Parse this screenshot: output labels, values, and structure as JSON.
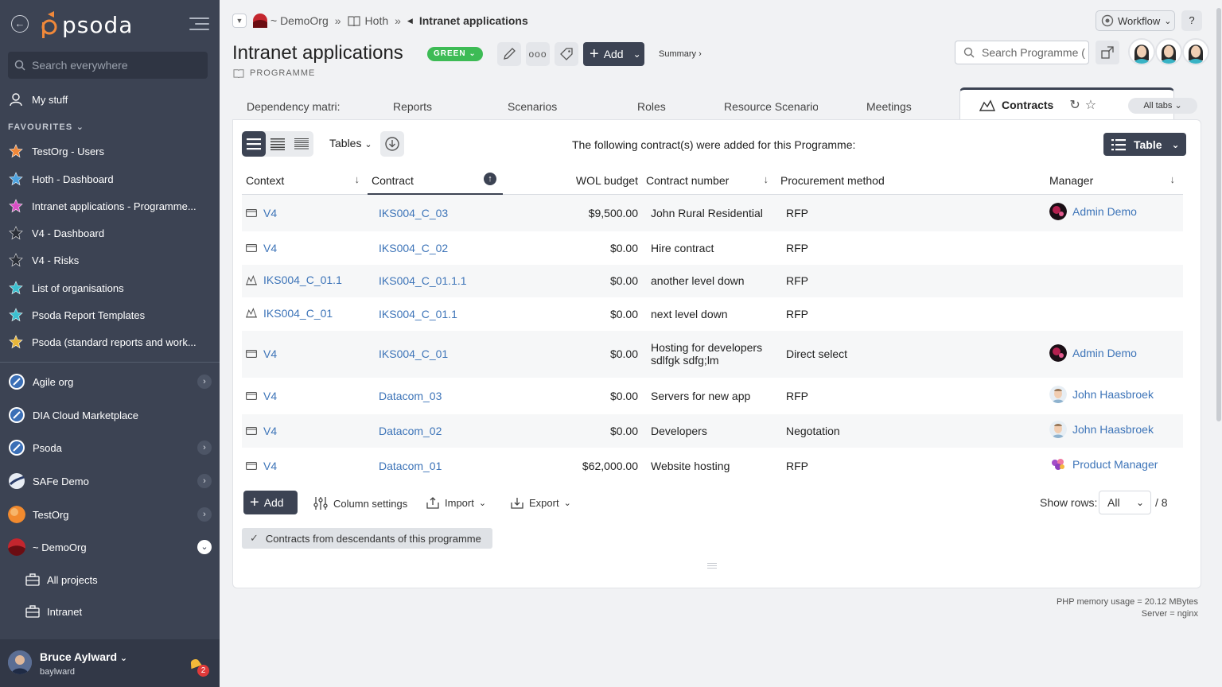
{
  "sidebar": {
    "logo_text": "psoda",
    "search_placeholder": "Search everywhere",
    "my_stuff": "My stuff",
    "favourites_header": "FAVOURITES",
    "favourites": [
      {
        "label": "TestOrg - Users",
        "color": "#f0883a"
      },
      {
        "label": "Hoth - Dashboard",
        "color": "#4da3e0"
      },
      {
        "label": "Intranet applications - Programme...",
        "color": "#d94fc4"
      },
      {
        "label": "V4 - Dashboard",
        "color": "#2b2f38"
      },
      {
        "label": "V4 - Risks",
        "color": "#2b2f38"
      },
      {
        "label": "List of organisations",
        "color": "#3cc0d0"
      },
      {
        "label": "Psoda Report Templates",
        "color": "#3cc0d0"
      },
      {
        "label": "Psoda (standard reports and work...",
        "color": "#e8b63a"
      }
    ],
    "orgs": [
      {
        "label": "Agile org"
      },
      {
        "label": "DIA Cloud Marketplace"
      },
      {
        "label": "Psoda"
      },
      {
        "label": "SAFe Demo"
      },
      {
        "label": "TestOrg"
      },
      {
        "label": "~ DemoOrg"
      }
    ],
    "sub_items": [
      "All projects",
      "Intranet"
    ],
    "user": {
      "name": "Bruce Aylward",
      "username": "baylward",
      "notifications": "2"
    }
  },
  "breadcrumb": {
    "org": "~ DemoOrg",
    "portfolio": "Hoth",
    "current": "Intranet applications"
  },
  "header": {
    "title": "Intranet applications",
    "rag": "GREEN",
    "type": "PROGRAMME",
    "add_label": "Add",
    "summary_label": "Summary ›",
    "workflow_label": "Workflow",
    "help_label": "?",
    "search_placeholder": "Search Programme (",
    "accent": "#3c4353",
    "green": "#3dbb55"
  },
  "tabs": {
    "items": [
      "Dependency matri:",
      "Reports",
      "Scenarios",
      "Roles",
      "Resource Scenario:",
      "Meetings"
    ],
    "active": "Contracts",
    "all_tabs": "All tabs"
  },
  "card": {
    "tables_label": "Tables",
    "info": "The following contract(s) were added for this Programme:",
    "table_button": "Table",
    "columns": [
      "Context",
      "Contract",
      "WOL budget",
      "Contract number",
      "Procurement method",
      "Manager"
    ],
    "rows": [
      {
        "context": "V4",
        "ctx_icon": "folder-icon",
        "contract": "IKS004_C_03",
        "budget": "$9,500.00",
        "number": "John Rural Residential",
        "number2": "",
        "method": "RFP",
        "manager": "Admin Demo",
        "mgr_avatar": "admin"
      },
      {
        "context": "V4",
        "ctx_icon": "folder-icon",
        "contract": "IKS004_C_02",
        "budget": "$0.00",
        "number": "Hire contract",
        "number2": "",
        "method": "RFP",
        "manager": "",
        "mgr_avatar": ""
      },
      {
        "context": "IKS004_C_01.1",
        "ctx_icon": "contract-icon",
        "contract": "IKS004_C_01.1.1",
        "budget": "$0.00",
        "number": "another level down",
        "number2": "",
        "method": "RFP",
        "manager": "",
        "mgr_avatar": ""
      },
      {
        "context": "IKS004_C_01",
        "ctx_icon": "contract-icon",
        "contract": "IKS004_C_01.1",
        "budget": "$0.00",
        "number": "next level down",
        "number2": "",
        "method": "RFP",
        "manager": "",
        "mgr_avatar": ""
      },
      {
        "context": "V4",
        "ctx_icon": "folder-icon",
        "contract": "IKS004_C_01",
        "budget": "$0.00",
        "number": "Hosting for developers",
        "number2": "sdlfgk sdfg;lm",
        "method": "Direct select",
        "manager": "Admin Demo",
        "mgr_avatar": "admin"
      },
      {
        "context": "V4",
        "ctx_icon": "folder-icon",
        "contract": "Datacom_03",
        "budget": "$0.00",
        "number": "Servers for new app",
        "number2": "",
        "method": "RFP",
        "manager": "John Haasbroek",
        "mgr_avatar": "john"
      },
      {
        "context": "V4",
        "ctx_icon": "folder-icon",
        "contract": "Datacom_02",
        "budget": "$0.00",
        "number": "Developers",
        "number2": "",
        "method": "Negotation",
        "manager": "John Haasbroek",
        "mgr_avatar": "john"
      },
      {
        "context": "V4",
        "ctx_icon": "folder-icon",
        "contract": "Datacom_01",
        "budget": "$62,000.00",
        "number": "Website hosting",
        "number2": "",
        "method": "RFP",
        "manager": "Product Manager",
        "mgr_avatar": "product"
      }
    ],
    "footer": {
      "add": "Add",
      "column_settings": "Column settings",
      "import": "Import",
      "export": "Export",
      "show_rows": "Show rows:",
      "rows_value": "All",
      "rows_total": "/ 8"
    },
    "descendants_chip": "Contracts from descendants of this programme"
  },
  "memory": {
    "line1": "PHP memory usage = 20.12 MBytes",
    "line2": "Server = nginx"
  }
}
